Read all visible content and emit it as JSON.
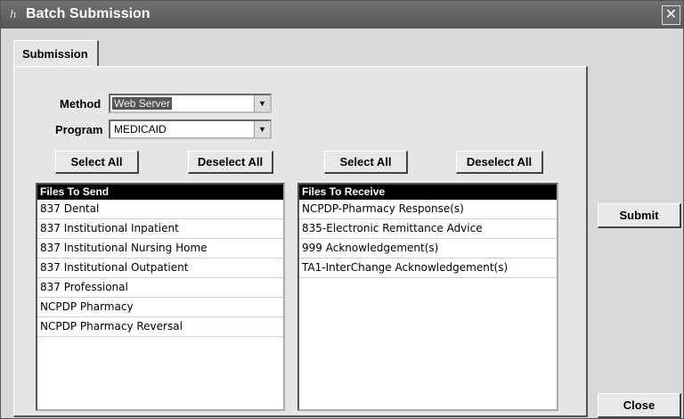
{
  "window": {
    "title": "Batch Submission",
    "title_icon": "app-icon",
    "close_glyph": "✕"
  },
  "tabs": [
    {
      "label": "Submission"
    }
  ],
  "form": {
    "method_label": "Method",
    "method_value": "Web Server",
    "program_label": "Program",
    "program_value": "MEDICAID"
  },
  "send": {
    "select_all": "Select All",
    "deselect_all": "Deselect All",
    "header": "Files To Send",
    "items": [
      "837 Dental",
      "837 Institutional Inpatient",
      "837 Institutional Nursing Home",
      "837 Institutional Outpatient",
      "837 Professional",
      "NCPDP Pharmacy",
      "NCPDP Pharmacy Reversal"
    ]
  },
  "receive": {
    "select_all": "Select All",
    "deselect_all": "Deselect All",
    "header": "Files To Receive",
    "items": [
      "NCPDP-Pharmacy Response(s)",
      "835-Electronic Remittance Advice",
      "999 Acknowledgement(s)",
      "TA1-InterChange Acknowledgement(s)"
    ]
  },
  "actions": {
    "submit": "Submit",
    "close": "Close"
  }
}
